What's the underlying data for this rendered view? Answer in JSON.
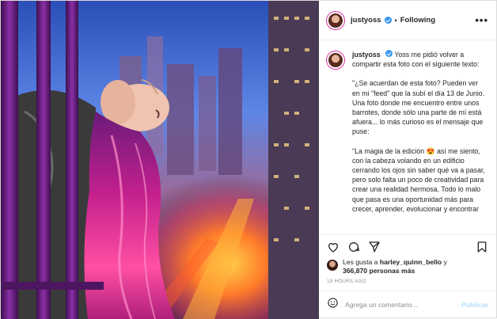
{
  "header": {
    "username": "justyoss",
    "separator": "•",
    "follow_status": "Following",
    "more_label": "•••"
  },
  "caption": {
    "username": "justyoss",
    "intro": "Yoss me pidió volver a compartir esta foto con el siguiente texto:",
    "paragraph_1": "\"¿Se acuerdan de esta foto? Pueden ver en mi \"feed\" que la subí el día 13 de Junio. Una foto donde me encuentro entre unos barrotes, donde sólo una parte de mí está afuera... lo más curioso es el mensaje que puse:",
    "paragraph_2": "\"La magia de la edición 😍 así me siento, con la cabeza volando en un edificio cerrando los ojos sin saber qué va a pasar, pero solo falta un poco de creatividad para crear una realidad hermosa. Todo lo malo que pasa es una oportunidad más para crecer, aprender, evolucionar y encontrar"
  },
  "likes": {
    "prefix": "Les gusta a",
    "user": "harley_quinn_bello",
    "joiner": "y",
    "count": "366,870 personas más"
  },
  "timestamp": "19 HOURS AGO",
  "comment": {
    "placeholder": "Agrega un comentario...",
    "publish_label": "Publicar"
  },
  "icons": {
    "like": "heart-icon",
    "comment": "comment-icon",
    "share": "share-icon",
    "save": "bookmark-icon",
    "emoji": "emoji-icon"
  },
  "colors": {
    "verified": "#3897f0",
    "publish_disabled": "#b2dffc",
    "muted": "#8e8e8e"
  }
}
